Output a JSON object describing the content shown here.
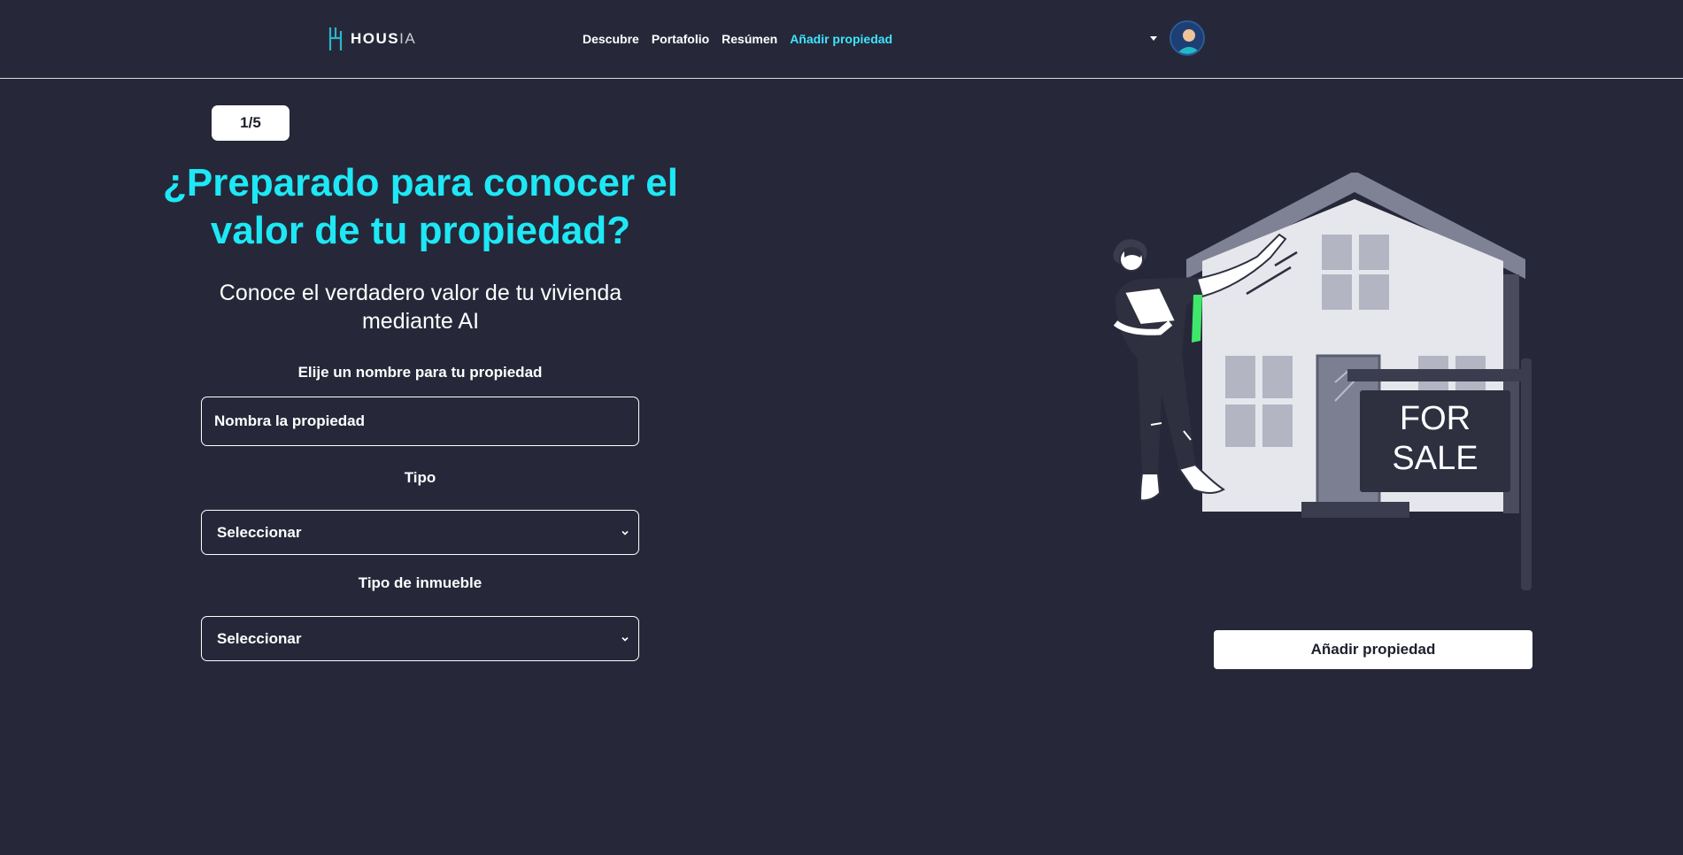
{
  "nav": {
    "brand_main": "HOUS",
    "brand_suffix": "IA",
    "links": [
      "Descubre",
      "Portafolio",
      "Resúmen",
      "Añadir propiedad"
    ],
    "active_link": "Añadir propiedad"
  },
  "step": {
    "label": "1/5"
  },
  "hero": {
    "title": "¿Preparado para conocer el valor de tu propiedad?",
    "subtitle": "Conoce el verdadero valor de tu vivienda mediante AI"
  },
  "form": {
    "name_label": "Elije un nombre para tu propiedad",
    "name_placeholder": "Nombra la propiedad",
    "type_label": "Tipo",
    "type_value": "Seleccionar",
    "property_type_label": "Tipo de inmueble",
    "property_type_value": "Seleccionar"
  },
  "illustration": {
    "sign_line1": "FOR",
    "sign_line2": "SALE"
  },
  "actions": {
    "add_property": "Añadir propiedad"
  },
  "colors": {
    "background": "#262839",
    "accent": "#1ee8f5",
    "nav_active": "#3ee5ff",
    "button_bg": "#ffffff"
  },
  "icons": [
    "logo-mark-icon",
    "caret-down-icon",
    "user-avatar-icon",
    "chevron-down-icon"
  ]
}
